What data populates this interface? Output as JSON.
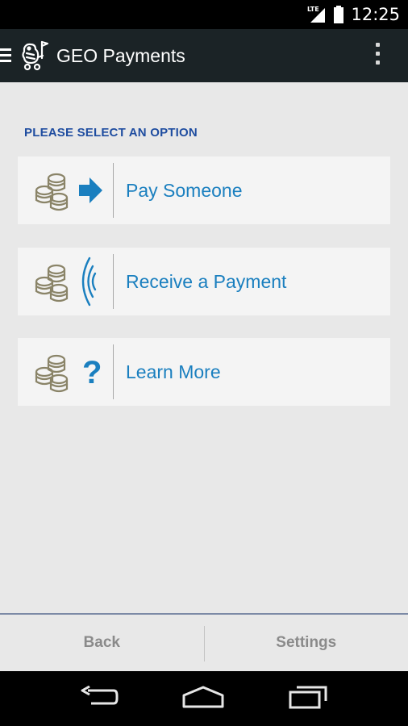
{
  "status_bar": {
    "network": "LTE",
    "time": "12:25"
  },
  "action_bar": {
    "title": "GEO Payments"
  },
  "main": {
    "section_label": "PLEASE SELECT AN OPTION",
    "options": [
      {
        "label": "Pay Someone",
        "icon": "arrow-right-icon"
      },
      {
        "label": "Receive a Payment",
        "icon": "wireless-signal-icon"
      },
      {
        "label": "Learn More",
        "icon": "question-mark-icon"
      }
    ]
  },
  "bottom_bar": {
    "back_label": "Back",
    "settings_label": "Settings"
  },
  "colors": {
    "action_bar": "#1b2326",
    "section_label": "#1f4da0",
    "option_text": "#1a7fbf",
    "coin_icon": "#8a8468",
    "bottom_text": "#8a8a8a"
  }
}
